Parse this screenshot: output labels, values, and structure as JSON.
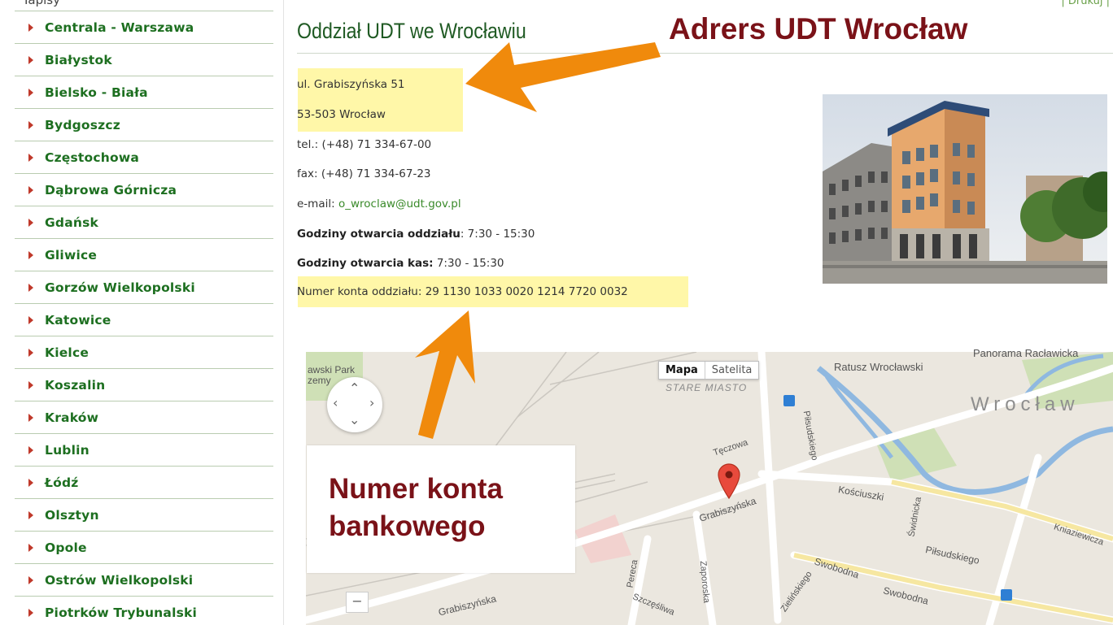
{
  "sidebar": {
    "top_fragment": "Iapisy",
    "items": [
      {
        "label": "Centrala - Warszawa"
      },
      {
        "label": "Białystok"
      },
      {
        "label": "Bielsko - Biała"
      },
      {
        "label": "Bydgoszcz"
      },
      {
        "label": "Częstochowa"
      },
      {
        "label": "Dąbrowa Górnicza"
      },
      {
        "label": "Gdańsk"
      },
      {
        "label": "Gliwice"
      },
      {
        "label": "Gorzów Wielkopolski"
      },
      {
        "label": "Katowice"
      },
      {
        "label": "Kielce"
      },
      {
        "label": "Koszalin"
      },
      {
        "label": "Kraków"
      },
      {
        "label": "Lublin"
      },
      {
        "label": "Łódź"
      },
      {
        "label": "Olsztyn"
      },
      {
        "label": "Opole"
      },
      {
        "label": "Ostrów Wielkopolski"
      },
      {
        "label": "Piotrków Trybunalski"
      }
    ]
  },
  "main": {
    "print_link": "| Drukuj |",
    "title": "Oddział UDT we Wrocławiu",
    "address_line1": "ul. Grabiszyńska 51",
    "address_line2": "53-503 Wrocław",
    "tel": "tel.: (+48) 71 334-67-00",
    "fax": "fax: (+48) 71 334-67-23",
    "email_label": "e-mail: ",
    "email": "o_wroclaw@udt.gov.pl",
    "hours_branch_label": "Godziny otwarcia oddziału",
    "hours_branch": ": 7:30 - 15:30",
    "hours_cash_label": "Godziny otwarcia kas:",
    "hours_cash": " 7:30 - 15:30",
    "account": "Numer konta oddziału: 29 1130 1033 0020 1214 7720 0032"
  },
  "annotations": {
    "address_title": "Adrers UDT Wrocław",
    "account_line1": "Numer konta",
    "account_line2": "bankowego",
    "accent_color": "#f08a0c",
    "text_color": "#7a1218"
  },
  "map": {
    "btn_map": "Mapa",
    "btn_satellite": "Satelita",
    "zoom_minus": "−",
    "labels": {
      "park": "awski Park",
      "park2": "zemy",
      "stare": "STARE MIASTO",
      "ratusz": "Ratusz Wrocławski",
      "panorama": "Panorama Racławicka",
      "city": "Wrocław",
      "teczowa": "Tęczowa",
      "pilsudskiego1": "Piłsudskiego",
      "grabiszynska1": "Grabiszyńska",
      "kosciuszki": "Kościuszki",
      "swidnicka": "Świdnicka",
      "pilsudskiego2": "Piłsudskiego",
      "kniaziewicza": "Kniaziewicza",
      "swobodna1": "Swobodna",
      "swobodna2": "Swobodna",
      "pereca": "Pereca",
      "zaporoska": "Zaporoska",
      "zielinskiego": "Zielińskiego",
      "szczesliwa": "Szczęśliwa",
      "grabiszynska2": "Grabiszyńska"
    }
  }
}
